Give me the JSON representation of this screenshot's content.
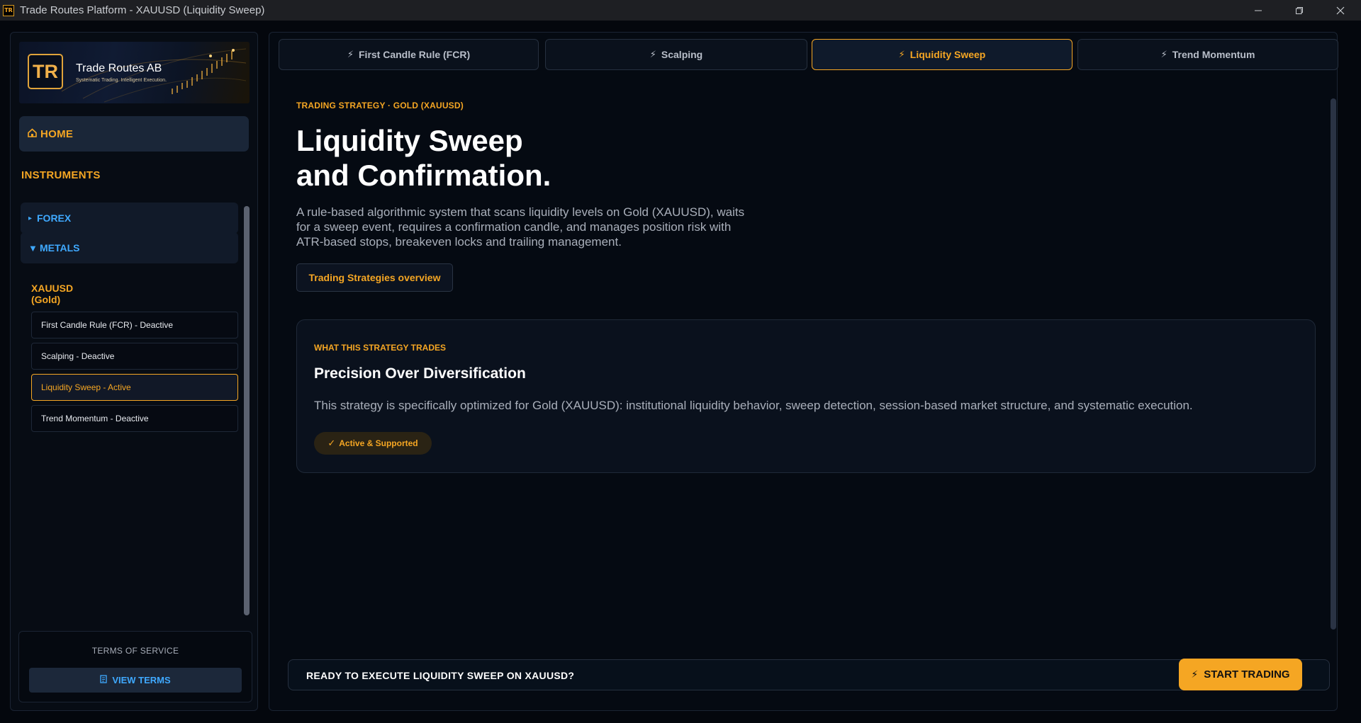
{
  "window": {
    "icon_text": "TR",
    "title": "Trade Routes Platform - XAUUSD (Liquidity Sweep)",
    "controls": [
      "minimize-icon",
      "restore-icon",
      "close-icon"
    ]
  },
  "sidebar": {
    "logo": {
      "mark": "TR",
      "name": "Trade Routes AB",
      "tagline": "Systematic Trading. Intelligent Execution."
    },
    "home": {
      "icon": "home-icon",
      "label": "HOME"
    },
    "instruments_title": "INSTRUMENTS",
    "categories": [
      {
        "label": "FOREX",
        "icon": "caret-right-icon",
        "expanded": false
      },
      {
        "label": "METALS",
        "icon": "caret-down-icon",
        "expanded": true
      }
    ],
    "instrument": {
      "name_line1": "XAUUSD",
      "name_line2": "(Gold)"
    },
    "strategies": [
      {
        "label": "First Candle Rule (FCR) - Deactive",
        "active": false
      },
      {
        "label": "Scalping - Deactive",
        "active": false
      },
      {
        "label": "Liquidity Sweep - Active",
        "active": true
      },
      {
        "label": "Trend Momentum - Deactive",
        "active": false
      }
    ],
    "terms": {
      "title": "TERMS OF SERVICE",
      "button_label": "VIEW TERMS",
      "button_icon": "document-icon"
    }
  },
  "tabs": [
    {
      "label": "First Candle Rule (FCR)",
      "icon": "bolt-icon",
      "active": false
    },
    {
      "label": "Scalping",
      "icon": "bolt-icon",
      "active": false
    },
    {
      "label": "Liquidity Sweep",
      "icon": "bolt-icon",
      "active": true
    },
    {
      "label": "Trend Momentum",
      "icon": "bolt-icon",
      "active": false
    }
  ],
  "hero": {
    "eyebrow": "TRADING STRATEGY · GOLD (XAUUSD)",
    "title_line1": "Liquidity Sweep",
    "title_line2": "and Confirmation.",
    "description": "A rule-based algorithmic system that scans liquidity levels on Gold (XAUUSD), waits for a sweep event, requires a confirmation candle, and manages position risk with ATR-based stops, breakeven locks and trailing management.",
    "overview_button": "Trading Strategies overview"
  },
  "card": {
    "eyebrow": "WHAT THIS STRATEGY TRADES",
    "title": "Precision Over Diversification",
    "text": "This strategy is specifically optimized for Gold (XAUUSD): institutional liquidity behavior, sweep detection, session-based market structure, and systematic execution.",
    "badge": "Active & Supported",
    "badge_icon": "checkmark-icon"
  },
  "footer": {
    "ready_text": "READY TO EXECUTE LIQUIDITY SWEEP ON XAUUSD?",
    "start_button": "START TRADING",
    "start_icon": "bolt-icon"
  },
  "colors": {
    "accent": "#f5a623",
    "link_blue": "#3fa9ff",
    "background": "#04070d",
    "panel": "#050a12"
  }
}
